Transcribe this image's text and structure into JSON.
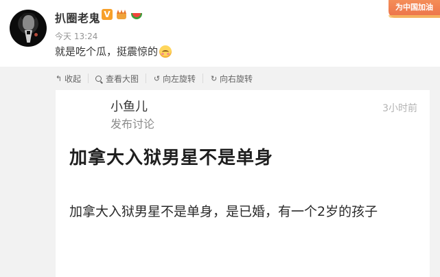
{
  "post": {
    "username": "扒圈老鬼",
    "verified_badge": "V",
    "time": "今天 13:24",
    "text": "就是吃个瓜，挺震惊的"
  },
  "brand_logo": "为中国加油",
  "toolbar": {
    "collapse": "收起",
    "view_large": "查看大图",
    "rotate_left": "向左旋转",
    "rotate_right": "向右旋转"
  },
  "card": {
    "name": "小鱼儿",
    "subtitle": "发布讨论",
    "time": "3小时前",
    "title": "加拿大入狱男星不是单身",
    "body": "加拿大入狱男星不是单身，是已婚，有一个2岁的孩子"
  },
  "colors": {
    "verified": "#f7a02a",
    "brand": "#e95a2a",
    "media_bg": "#f2f2f2"
  },
  "icons": [
    "collapse-arrow-icon",
    "search-icon",
    "rotate-left-icon",
    "rotate-right-icon"
  ]
}
